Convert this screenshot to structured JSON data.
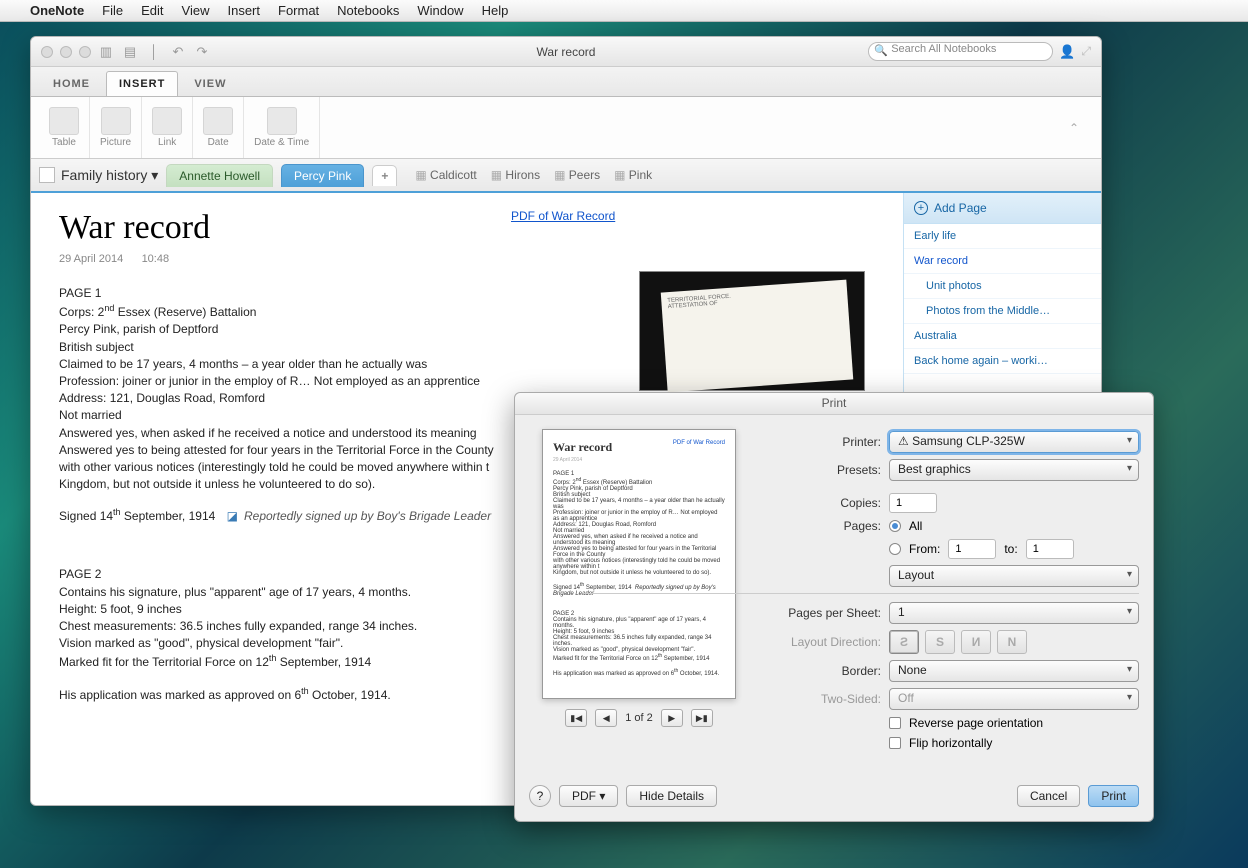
{
  "menubar": {
    "app": "OneNote",
    "items": [
      "File",
      "Edit",
      "View",
      "Insert",
      "Format",
      "Notebooks",
      "Window",
      "Help"
    ]
  },
  "window": {
    "title": "War record",
    "search_placeholder": "Search All Notebooks"
  },
  "ribbon": {
    "tabs": [
      "HOME",
      "INSERT",
      "VIEW"
    ],
    "active_tab": "INSERT",
    "groups": [
      "Table",
      "Picture",
      "Link",
      "Date",
      "Date & Time"
    ]
  },
  "notebook": "Family history",
  "sections": {
    "green": "Annette Howell",
    "blue": "Percy Pink"
  },
  "quick_tags": [
    "Caldicott",
    "Hirons",
    "Peers",
    "Pink"
  ],
  "page": {
    "title": "War record",
    "date": "29 April 2014",
    "time": "10:48",
    "pdf_link": "PDF of War Record"
  },
  "body": {
    "p1_label": "PAGE 1",
    "p1_l1a": "Corps: 2",
    "p1_l1b": " Essex (Reserve) Battalion",
    "p1_l2": "Percy Pink, parish of Deptford",
    "p1_l3": "British subject",
    "p1_l4": "Claimed to be 17 years, 4 months – a year older than he actually was",
    "p1_l5": "Profession: joiner or junior in the employ of R… Not employed as an apprentice",
    "p1_l6": "Address: 121, Douglas Road, Romford",
    "p1_l7": "Not married",
    "p1_l8": "Answered yes, when asked if he received a notice and understood its meaning",
    "p1_l9": "Answered yes to being attested for four years in the Territorial Force in the County ",
    "p1_l10": "with other various notices (interestingly told he could be moved anywhere within t",
    "p1_l11": "Kingdom, but not outside it unless he volunteered to do so).",
    "signed_a": "Signed 14",
    "signed_b": " September, 1914",
    "tag": "Reportedly signed up by Boy's Brigade Leader",
    "p2_label": "PAGE 2",
    "p2_l1": "Contains his signature, plus \"apparent\" age of 17 years, 4 months.",
    "p2_l2": "Height: 5 foot, 9 inches",
    "p2_l3": "Chest measurements: 36.5 inches fully expanded, range 34 inches.",
    "p2_l4": "Vision marked as \"good\", physical development \"fair\".",
    "p2_l5a": "Marked fit for the Territorial Force on 12",
    "p2_l5b": " September, 1914",
    "p2_l6a": "His application was marked as approved on 6",
    "p2_l6b": " October, 1914."
  },
  "pagelist": {
    "add": "Add Page",
    "items": [
      {
        "label": "Early life",
        "child": false
      },
      {
        "label": "War record",
        "child": false,
        "selected": true
      },
      {
        "label": "Unit photos",
        "child": true
      },
      {
        "label": "Photos from the Middle…",
        "child": true
      },
      {
        "label": "Australia",
        "child": false
      },
      {
        "label": "Back home again – worki…",
        "child": false
      }
    ]
  },
  "print": {
    "title": "Print",
    "labels": {
      "printer": "Printer:",
      "presets": "Presets:",
      "copies": "Copies:",
      "pages": "Pages:",
      "all": "All",
      "from": "From:",
      "to": "to:",
      "layout": "Layout",
      "pps": "Pages per Sheet:",
      "dir": "Layout Direction:",
      "border": "Border:",
      "twosided": "Two-Sided:",
      "reverse": "Reverse page orientation",
      "flip": "Flip horizontally"
    },
    "values": {
      "printer": "⚠ Samsung CLP-325W",
      "presets": "Best graphics",
      "copies": "1",
      "from": "1",
      "to": "1",
      "pps": "1",
      "border": "None",
      "twosided": "Off"
    },
    "pager": "1 of 2",
    "footer": {
      "help": "?",
      "pdf": "PDF ▾",
      "hide": "Hide Details",
      "cancel": "Cancel",
      "print": "Print"
    }
  }
}
